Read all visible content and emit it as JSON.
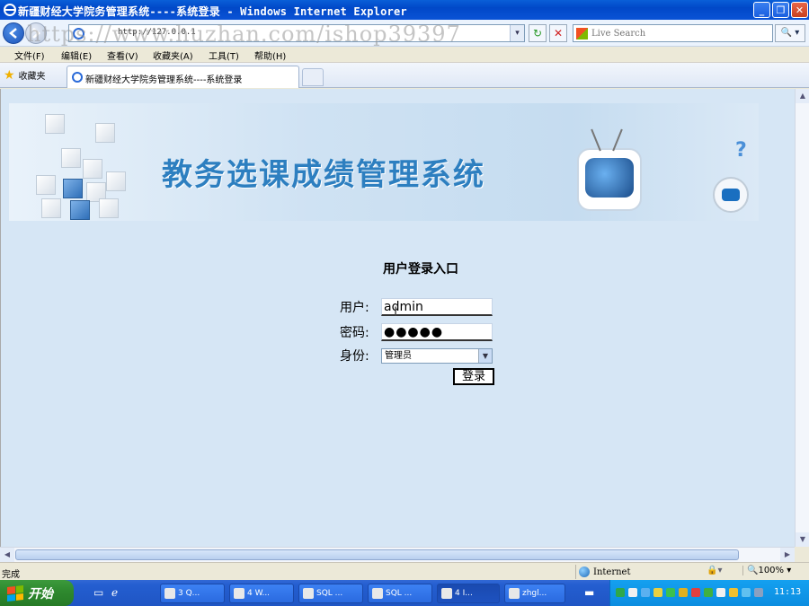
{
  "window": {
    "title": "新疆财经大学院务管理系统----系统登录 - Windows Internet Explorer",
    "minimize": "_",
    "maximize": "❐",
    "close": "✕"
  },
  "address": {
    "url": "http://127.0.0.1",
    "dropdown": "▾",
    "search_placeholder": "Live Search",
    "search_go": "🔍 ▾"
  },
  "watermark": "https://www.huzhan.com/ishop39397",
  "menu": [
    "文件(F)",
    "编辑(E)",
    "查看(V)",
    "收藏夹(A)",
    "工具(T)",
    "帮助(H)"
  ],
  "favorites_label": "收藏夹",
  "tab_label": "新疆财经大学院务管理系统----系统登录",
  "banner_title": "教务选课成绩管理系统",
  "login": {
    "heading": "用户登录入口",
    "user_label": "用户:",
    "user_value": "admin",
    "password_label": "密码:",
    "password_value": "●●●●●",
    "role_label": "身份:",
    "role_value": "管理员",
    "submit_label": "登录"
  },
  "status": {
    "text": "完成",
    "zone": "Internet",
    "zoom": "🔍100%  ▾"
  },
  "taskbar": {
    "start_label": "开始",
    "tasks": [
      "3 Q...",
      "4 W...",
      "SQL ...",
      "SQL ...",
      "4 I...",
      "zhgl..."
    ],
    "clock": "11:13"
  }
}
